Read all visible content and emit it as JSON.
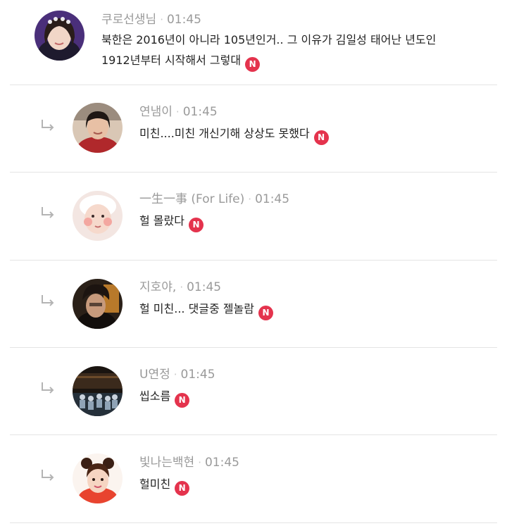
{
  "comments": [
    {
      "author": "쿠로선생님",
      "time": "01:45",
      "lines": [
        "북한은 2016년이 아니라 105년인거.. 그 이유가 김일성 태어난 년도인",
        "1912년부터 시작해서 그렇대"
      ],
      "badge": "N",
      "is_reply": false
    },
    {
      "author": "연냄이",
      "time": "01:45",
      "lines": [
        "미친....미친 개신기해 상상도 못했다"
      ],
      "badge": "N",
      "is_reply": true
    },
    {
      "author": "一生一事 (For Life)",
      "time": "01:45",
      "lines": [
        "헐 몰랐다"
      ],
      "badge": "N",
      "is_reply": true
    },
    {
      "author": "지호야,",
      "time": "01:45",
      "lines": [
        "헐 미친... 댓글중 젤놀람"
      ],
      "badge": "N",
      "is_reply": true
    },
    {
      "author": "U연정",
      "time": "01:45",
      "lines": [
        "씹소름"
      ],
      "badge": "N",
      "is_reply": true
    },
    {
      "author": "빛나는백현",
      "time": "01:45",
      "lines": [
        "헐미친"
      ],
      "badge": "N",
      "is_reply": true
    }
  ],
  "separator": "·",
  "colors": {
    "badge": "#e4334d",
    "meta_text": "#9a9a9a",
    "body_text": "#222222",
    "divider": "#e4e4e4"
  },
  "icons": {
    "reply": "reply-arrow-icon",
    "new_badge": "new-badge-icon"
  }
}
